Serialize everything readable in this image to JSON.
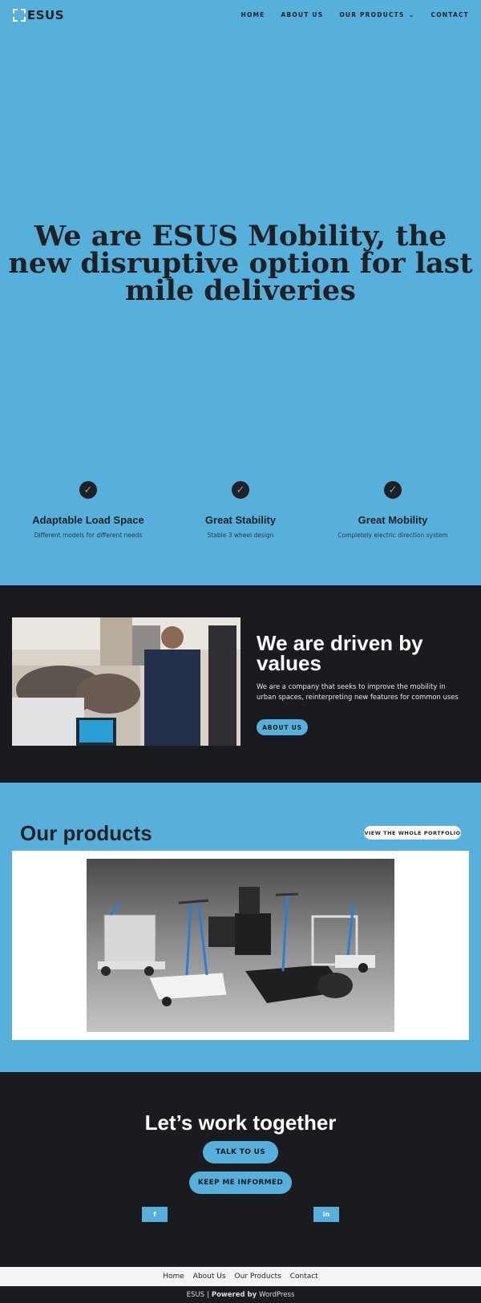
{
  "header": {
    "logo_text": "ESUS",
    "nav": [
      {
        "label": "HOME"
      },
      {
        "label": "ABOUT US"
      },
      {
        "label": "OUR PRODUCTS"
      },
      {
        "label": "CONTACT"
      }
    ]
  },
  "hero": {
    "title": "We are ESUS Mobility, the new disruptive option for last mile deliveries"
  },
  "features": [
    {
      "icon": "check-circle-icon",
      "title": "Adaptable Load Space",
      "text": "Different models for different needs"
    },
    {
      "icon": "check-circle-icon",
      "title": "Great Stability",
      "text": "Stable 3 wheel design"
    },
    {
      "icon": "check-circle-icon",
      "title": "Great Mobility",
      "text": "Completely electric direction system"
    }
  ],
  "values": {
    "title": "We are driven by values",
    "text": "We are a company that seeks to improve the mobility in urban spaces, reinterpreting new features for common uses",
    "button": "ABOUT US"
  },
  "products": {
    "title": "Our products",
    "button": "VIEW THE WHOLE PORTFOLIO"
  },
  "together": {
    "title": "Let’s work together",
    "btn_talk": "TALK TO US",
    "btn_keep": "KEEP ME INFORMED",
    "facebook": "f",
    "linkedin": "in"
  },
  "footer": {
    "nav": [
      {
        "label": "Home"
      },
      {
        "label": "About Us"
      },
      {
        "label": "Our Products"
      },
      {
        "label": "Contact"
      }
    ],
    "brand": "ESUS",
    "sep": "|",
    "powered": "Powered by",
    "wp": "WordPress"
  },
  "colors": {
    "accent": "#57b0dc",
    "dark": "#1a1b1f",
    "text": "#1f2125"
  }
}
